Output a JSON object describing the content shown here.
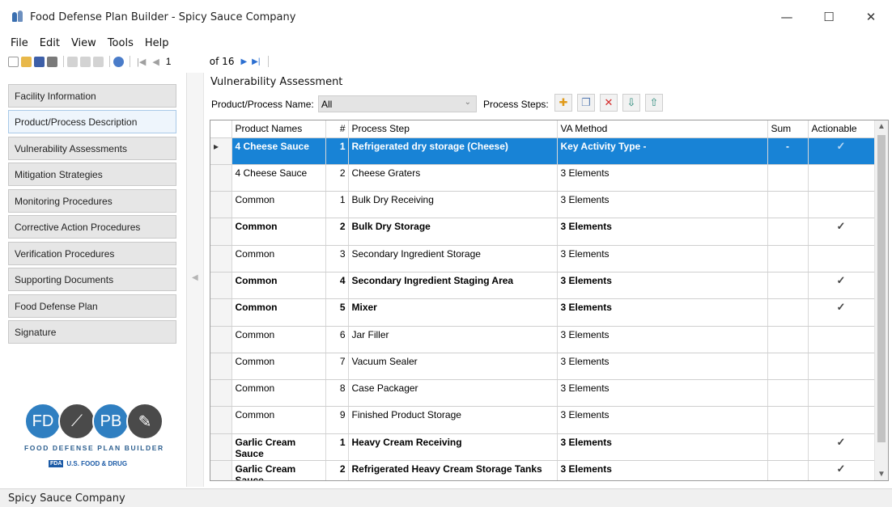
{
  "window": {
    "title": "Food Defense Plan Builder - Spicy Sauce Company",
    "controls": {
      "minimize": "—",
      "maximize": "☐",
      "close": "✕"
    }
  },
  "menu": [
    "File",
    "Edit",
    "View",
    "Tools",
    "Help"
  ],
  "toolbar": {
    "page_value": "1",
    "page_of": "of 16"
  },
  "sidebar": {
    "items": [
      {
        "label": "Facility Information",
        "selected": false
      },
      {
        "label": "Product/Process Description",
        "selected": true
      },
      {
        "label": "Vulnerability Assessments",
        "selected": false
      },
      {
        "label": "Mitigation Strategies",
        "selected": false
      },
      {
        "label": "Monitoring Procedures",
        "selected": false
      },
      {
        "label": "Corrective Action Procedures",
        "selected": false
      },
      {
        "label": "Verification Procedures",
        "selected": false
      },
      {
        "label": "Supporting Documents",
        "selected": false
      },
      {
        "label": "Food Defense Plan",
        "selected": false
      },
      {
        "label": "Signature",
        "selected": false
      }
    ],
    "logo": {
      "circle1": "FD",
      "circle3": "PB",
      "tagline": "FOOD DEFENSE PLAN BUILDER",
      "fda_box": "FDA",
      "fda_text": "U.S. FOOD & DRUG"
    }
  },
  "main": {
    "section_title": "Vulnerability Assessment",
    "filter_label": "Product/Process Name:",
    "filter_value": "All",
    "steps_label": "Process Steps:",
    "columns": [
      "Product Names",
      "#",
      "Process Step",
      "VA Method",
      "Sum",
      "Actionable"
    ],
    "rows": [
      {
        "product": "4 Cheese Sauce",
        "num": "1",
        "step": "Refrigerated dry storage (Cheese)",
        "method": "Key Activity Type -",
        "sum": "-",
        "actionable": "✓",
        "bold": true,
        "highlight": true
      },
      {
        "product": "4 Cheese Sauce",
        "num": "2",
        "step": "Cheese Graters",
        "method": "3 Elements",
        "sum": "",
        "actionable": "",
        "bold": false
      },
      {
        "product": "Common",
        "num": "1",
        "step": "Bulk Dry Receiving",
        "method": "3 Elements",
        "sum": "",
        "actionable": "",
        "bold": false
      },
      {
        "product": "Common",
        "num": "2",
        "step": "Bulk Dry Storage",
        "method": "3 Elements",
        "sum": "",
        "actionable": "✓",
        "bold": true
      },
      {
        "product": "Common",
        "num": "3",
        "step": "Secondary Ingredient Storage",
        "method": "3 Elements",
        "sum": "",
        "actionable": "",
        "bold": false
      },
      {
        "product": "Common",
        "num": "4",
        "step": "Secondary Ingredient Staging Area",
        "method": "3 Elements",
        "sum": "",
        "actionable": "✓",
        "bold": true
      },
      {
        "product": "Common",
        "num": "5",
        "step": "Mixer",
        "method": "3 Elements",
        "sum": "",
        "actionable": "✓",
        "bold": true
      },
      {
        "product": "Common",
        "num": "6",
        "step": "Jar Filler",
        "method": "3 Elements",
        "sum": "",
        "actionable": "",
        "bold": false
      },
      {
        "product": "Common",
        "num": "7",
        "step": "Vacuum Sealer",
        "method": "3 Elements",
        "sum": "",
        "actionable": "",
        "bold": false
      },
      {
        "product": "Common",
        "num": "8",
        "step": "Case Packager",
        "method": "3 Elements",
        "sum": "",
        "actionable": "",
        "bold": false
      },
      {
        "product": "Common",
        "num": "9",
        "step": "Finished Product Storage",
        "method": "3 Elements",
        "sum": "",
        "actionable": "",
        "bold": false
      },
      {
        "product": "Garlic Cream Sauce",
        "num": "1",
        "step": "Heavy Cream Receiving",
        "method": "3 Elements",
        "sum": "",
        "actionable": "✓",
        "bold": true
      },
      {
        "product": "Garlic Cream Sauce",
        "num": "2",
        "step": "Refrigerated Heavy Cream Storage Tanks",
        "method": "3 Elements",
        "sum": "",
        "actionable": "✓",
        "bold": true
      }
    ]
  },
  "status": {
    "text": "Spicy Sauce Company"
  },
  "colors": {
    "highlight": "#1883d6",
    "accent": "#2c6fd1"
  }
}
